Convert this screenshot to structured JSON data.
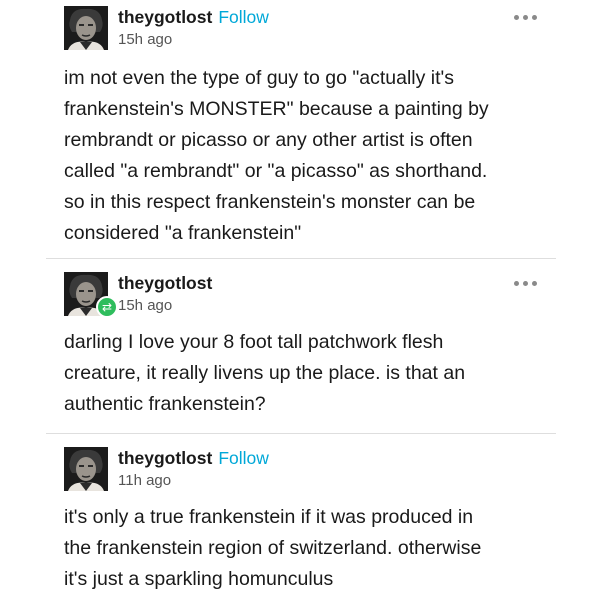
{
  "colors": {
    "follow": "#00a8d8",
    "reblog_badge": "#2fbd5d",
    "text": "#1a1a1a",
    "meta": "#555555"
  },
  "posts": [
    {
      "username": "theygotlost",
      "follow_label": "Follow",
      "time": "15h ago",
      "lines": [
        "im not even the type of guy to go \"actually it's",
        "frankenstein's MONSTER\" because a painting by",
        "rembrandt or picasso or any other artist is often",
        "called \"a rembrandt\" or \"a picasso\" as shorthand.",
        "so in this respect frankenstein's monster can be",
        "considered \"a frankenstein\""
      ]
    },
    {
      "username": "theygotlost",
      "time": "15h ago",
      "badge_icon": "reblog-icon",
      "lines": [
        "darling I love your 8 foot tall patchwork flesh",
        "creature, it really livens up the place. is that an",
        "authentic frankenstein?"
      ]
    },
    {
      "username": "theygotlost",
      "follow_label": "Follow",
      "time": "11h ago",
      "lines": [
        "it's only a true frankenstein if it was produced in",
        "the frankenstein region of switzerland. otherwise",
        "it's just a sparkling homunculus"
      ]
    }
  ]
}
